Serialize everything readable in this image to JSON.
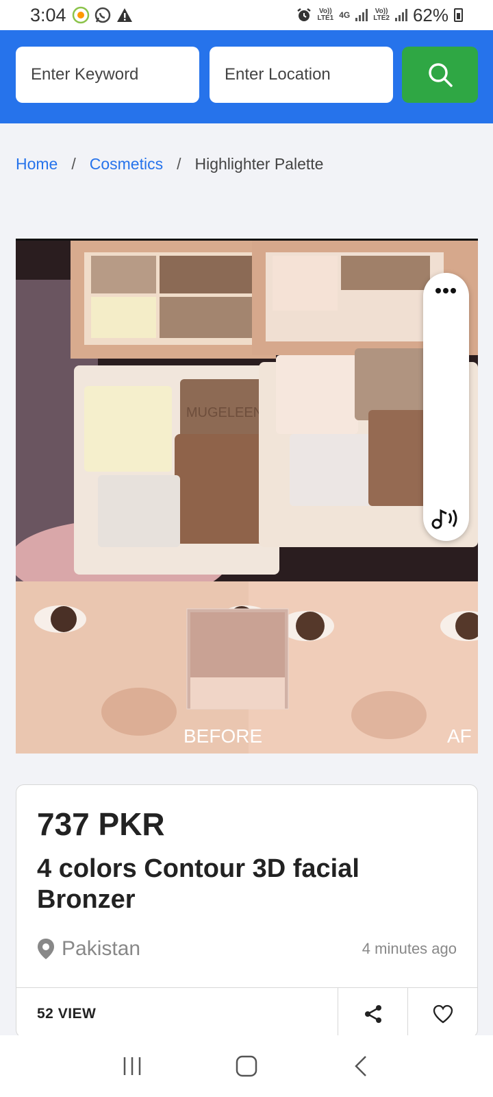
{
  "status_bar": {
    "time": "3:04",
    "volte1": "Vo))",
    "lte1": "LTE1",
    "network": "4G",
    "volte2": "Vo))",
    "lte2": "LTE2",
    "battery": "62%"
  },
  "search": {
    "keyword_placeholder": "Enter Keyword",
    "location_placeholder": "Enter Location",
    "search_icon": "search-icon"
  },
  "breadcrumb": {
    "home": "Home",
    "category": "Cosmetics",
    "current": "Highlighter Palette",
    "separator": "/"
  },
  "product": {
    "image_brand_text": "MUGELEEN",
    "image_before_label": "BEFORE",
    "image_after_label": "AF",
    "price": "737 PKR",
    "title": "4 colors Contour 3D facial Bronzer",
    "location": "Pakistan",
    "posted": "4 minutes ago",
    "views": "52 VIEW"
  },
  "colors": {
    "header_blue": "#2673eb",
    "search_green": "#2fa744",
    "link_blue": "#2673eb"
  }
}
